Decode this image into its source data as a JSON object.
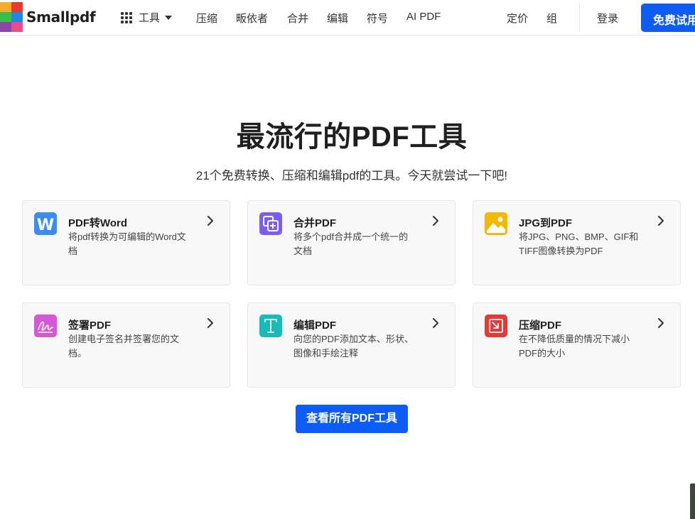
{
  "header": {
    "logo_text": "Smallpdf",
    "tools_label": "工具",
    "nav": [
      "压缩",
      "畈依者",
      "合并",
      "编辑",
      "符号",
      "AI PDF"
    ],
    "pricing": "定价",
    "teams": "组",
    "login": "登录",
    "trial": "免费试用"
  },
  "hero": {
    "title": "最流行的PDF工具",
    "subtitle": "21个免费转换、压缩和编辑pdf的工具。今天就尝试一下吧!"
  },
  "cards": [
    {
      "title": "PDF转Word",
      "desc": "将pdf转换为可编辑的Word文档",
      "icon": "word-icon",
      "color": "#3b8ef0"
    },
    {
      "title": "合并PDF",
      "desc": "将多个pdf合并成一个统一的文档",
      "icon": "merge-icon",
      "color": "#7b5cf5"
    },
    {
      "title": "JPG到PDF",
      "desc": "将JPG、PNG、BMP、GIF和TIFF图像转换为PDF",
      "icon": "image-icon",
      "color": "#f5b800"
    },
    {
      "title": "签署PDF",
      "desc": "创建电子签名并签署您的文档。",
      "icon": "signature-icon",
      "color": "#d658d6"
    },
    {
      "title": "编辑PDF",
      "desc": "向您的PDF添加文本、形状、图像和手绘注释",
      "icon": "text-icon",
      "color": "#14bcbc"
    },
    {
      "title": "压缩PDF",
      "desc": "在不降低质量的情况下减小PDF的大小",
      "icon": "compress-icon",
      "color": "#e53935"
    }
  ],
  "cta": {
    "all_tools": "查看所有PDF工具"
  },
  "colors": {
    "primary": "#0d5cf5"
  }
}
